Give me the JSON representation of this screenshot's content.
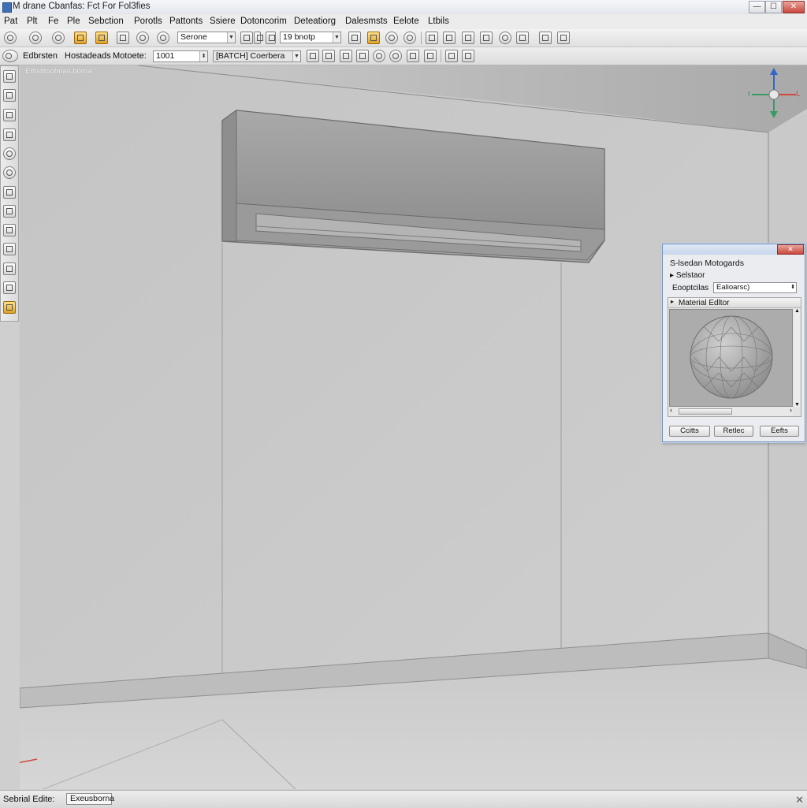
{
  "window": {
    "title": "M drane Cbanfas: Fct For Fol3fies",
    "minimize_label": "—",
    "maximize_label": "☐",
    "close_label": "✕"
  },
  "menu": [
    "Pat",
    "Plt",
    "Fe",
    "Ple",
    "Sebction",
    "Porotls",
    "Pattonts",
    "Ssiere",
    "Dotoncorim",
    "Deteatiorg",
    "Dalesmsts",
    "Eelote",
    "Ltbils"
  ],
  "toolbar1": {
    "combo_1": "Serone",
    "combo_2": "19 bnotp"
  },
  "toolbar2": {
    "label_1": "Edbrsten",
    "label_2": "Hostadeads",
    "label_3": "Motoete:",
    "value_field": "1001",
    "combo": "[BATCH] Coerbera"
  },
  "viewport": {
    "label": "Ethstitootmas.borna",
    "axis_labels": {
      "x": "L",
      "y": "r",
      "z": "Z"
    }
  },
  "dialog": {
    "close_label": "✕",
    "heading": "S-lsedan  Motogards",
    "row_1": "Selstaor",
    "row_2_label": "Eooptcilas",
    "row_2_value": "Ealioarsc)",
    "panel_title": "Material Edltor",
    "buttons": [
      "Ccitts",
      "Retlec",
      "Eefts"
    ]
  },
  "status": {
    "label": "Sebrial Edite:",
    "field": "Exeusborna"
  },
  "colors": {
    "gizmo_x": "#d2473a",
    "gizmo_y": "#3a9a64",
    "gizmo_z": "#3466c8",
    "dialog_border": "#6d8fbf"
  }
}
